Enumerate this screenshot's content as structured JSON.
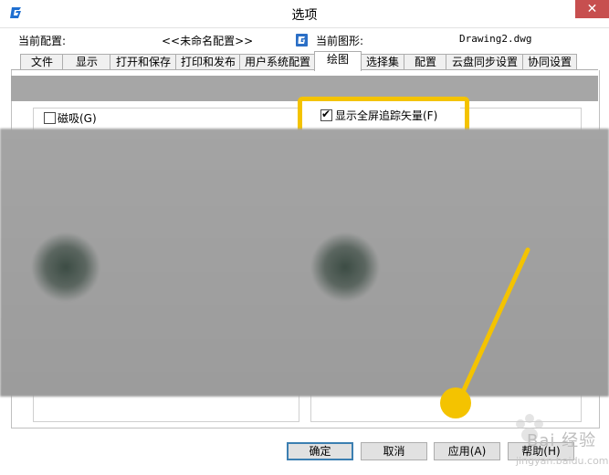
{
  "window": {
    "title": "选项",
    "close_symbol": "✕"
  },
  "config": {
    "current_profile_label": "当前配置:",
    "current_profile_value": "<<未命名配置>>",
    "current_drawing_label": "当前图形:",
    "current_drawing_value": "Drawing2.dwg"
  },
  "tabs": [
    {
      "label": "文件"
    },
    {
      "label": "显示"
    },
    {
      "label": "打开和保存"
    },
    {
      "label": "打印和发布"
    },
    {
      "label": "用户系统配置"
    },
    {
      "label": "绘图"
    },
    {
      "label": "选择集"
    },
    {
      "label": "配置"
    },
    {
      "label": "云盘同步设置"
    },
    {
      "label": "协同设置"
    }
  ],
  "options": {
    "magnet_label": "磁吸(G)",
    "magnet_checked": false,
    "fullscreen_tracking_label": "显示全屏追踪矢量(F)",
    "fullscreen_tracking_checked": true
  },
  "buttons": {
    "ok": "确定",
    "cancel": "取消",
    "apply": "应用(A)",
    "help": "帮助(H)"
  },
  "watermark": {
    "text": "Bai 经验",
    "sub": "jingyan.baidu.com"
  },
  "colors": {
    "highlight": "#f4c300",
    "close_button": "#c74f4f",
    "blur_gray": "#a6a6a6"
  },
  "icons": {
    "app": "app-logo-icon",
    "drawing": "drawing-file-icon"
  }
}
